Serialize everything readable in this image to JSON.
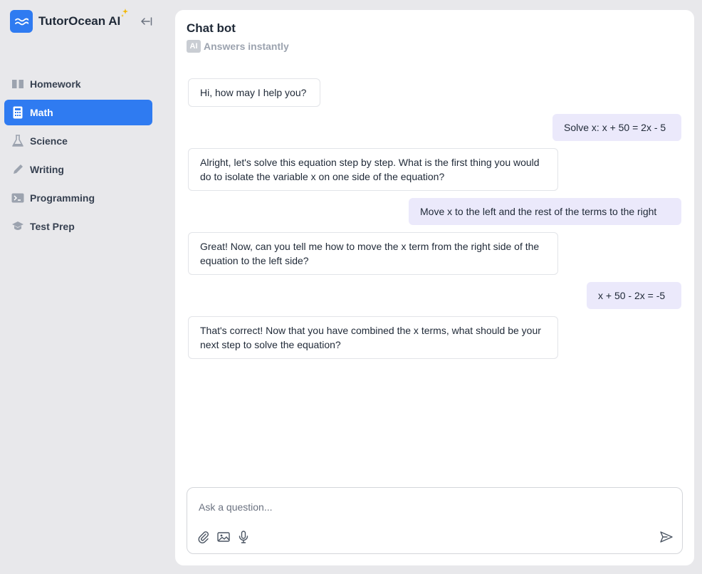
{
  "brand": {
    "name": "TutorOcean AI",
    "logo_color": "#2f7bf1",
    "sparkle_color": "#f2b705"
  },
  "sidebar": {
    "items": [
      {
        "label": "Homework",
        "icon": "book-icon",
        "active": false
      },
      {
        "label": "Math",
        "icon": "calculator-icon",
        "active": true
      },
      {
        "label": "Science",
        "icon": "flask-icon",
        "active": false
      },
      {
        "label": "Writing",
        "icon": "pencil-icon",
        "active": false
      },
      {
        "label": "Programming",
        "icon": "terminal-icon",
        "active": false
      },
      {
        "label": "Test Prep",
        "icon": "graduation-cap-icon",
        "active": false
      }
    ]
  },
  "chat": {
    "title": "Chat bot",
    "badge": "AI",
    "subtitle": "Answers instantly",
    "messages": [
      {
        "role": "bot",
        "text": "Hi, how may I help you?"
      },
      {
        "role": "user",
        "text": "Solve x: x + 50 = 2x - 5"
      },
      {
        "role": "bot",
        "text": "Alright, let's solve this equation step by step. What is the first thing you would do to isolate the variable x on one side of the equation?"
      },
      {
        "role": "user",
        "text": "Move x to the left and the rest of the terms to the right"
      },
      {
        "role": "bot",
        "text": "Great! Now, can you tell me how to move the x term from the right side of the equation to the left side?"
      },
      {
        "role": "user",
        "text": "x + 50 - 2x = -5"
      },
      {
        "role": "bot",
        "text": "That's correct! Now that you have combined the x terms, what should be your next step to solve the equation?"
      }
    ]
  },
  "composer": {
    "value": "",
    "placeholder": "Ask a question...",
    "tools": [
      "paperclip-icon",
      "image-icon",
      "microphone-icon"
    ],
    "send_icon": "send-icon"
  },
  "colors": {
    "accent": "#2f7bf1",
    "user_bubble": "#ebe9fb",
    "background": "#e8e8eb"
  }
}
